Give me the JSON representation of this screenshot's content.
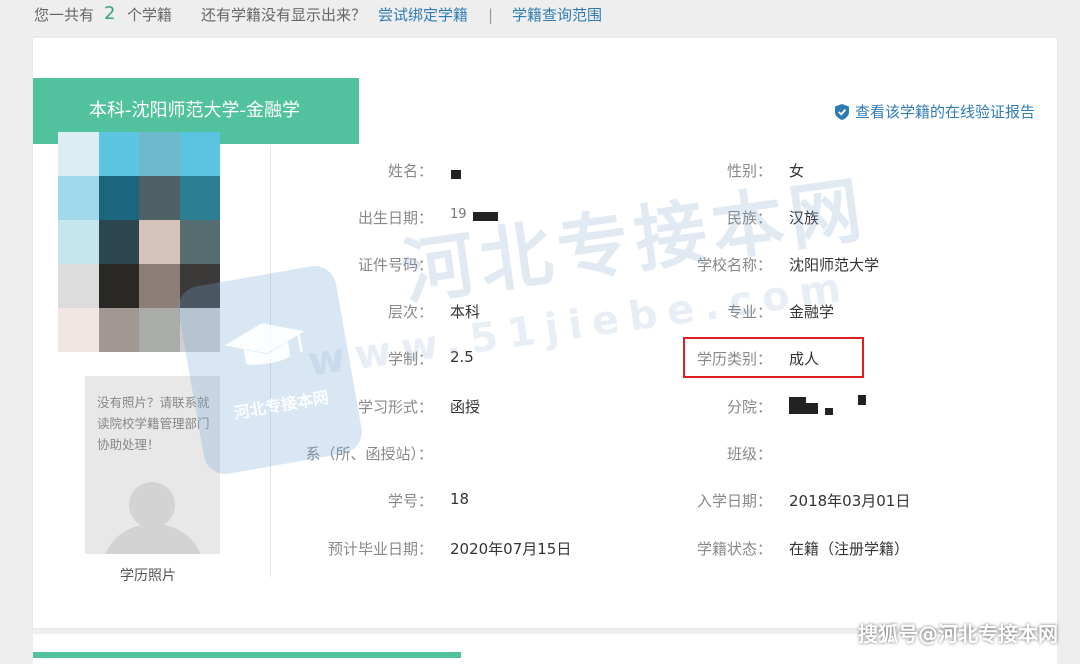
{
  "topbar": {
    "prefix": "您一共有",
    "count": "2",
    "suffix": "个学籍",
    "question": "还有学籍没有显示出来？",
    "bind_link": "尝试绑定学籍",
    "separator": "|",
    "range_link": "学籍查询范围"
  },
  "card": {
    "title": "本科-沈阳师范大学-金融学",
    "verify_link": "查看该学籍的在线验证报告",
    "no_photo_text": "没有照片？请联系就读院校学籍管理部门协助处理！",
    "photo_caption": "学历照片"
  },
  "fields_left": [
    {
      "label": "姓名：",
      "value": ""
    },
    {
      "label": "出生日期：",
      "value": "19"
    },
    {
      "label": "证件号码：",
      "value": ""
    },
    {
      "label": "层次：",
      "value": "本科"
    },
    {
      "label": "学制：",
      "value": "2.5"
    },
    {
      "label": "学习形式：",
      "value": "函授"
    },
    {
      "label": "系（所、函授站）：",
      "value": ""
    },
    {
      "label": "学号：",
      "value": "18"
    },
    {
      "label": "预计毕业日期：",
      "value": "2020年07月15日"
    }
  ],
  "fields_right": [
    {
      "label": "性别：",
      "value": "女"
    },
    {
      "label": "民族：",
      "value": "汉族"
    },
    {
      "label": "学校名称：",
      "value": "沈阳师范大学"
    },
    {
      "label": "专业：",
      "value": "金融学"
    },
    {
      "label": "学历类别：",
      "value": "成人"
    },
    {
      "label": "分院：",
      "value": ""
    },
    {
      "label": "班级：",
      "value": ""
    },
    {
      "label": "入学日期：",
      "value": "2018年03月01日"
    },
    {
      "label": "学籍状态：",
      "value": "在籍（注册学籍）"
    }
  ],
  "watermark": {
    "main": "河北专接本网",
    "url": "www.51jiebe.com",
    "logo_text": "河北专接本网",
    "corner": "搜狐号@河北专接本网"
  },
  "colors": {
    "accent": "#52c29e",
    "link": "#2f7cb5",
    "highlight_border": "#e02020"
  },
  "icons": {
    "verify": "shield-check-icon"
  }
}
